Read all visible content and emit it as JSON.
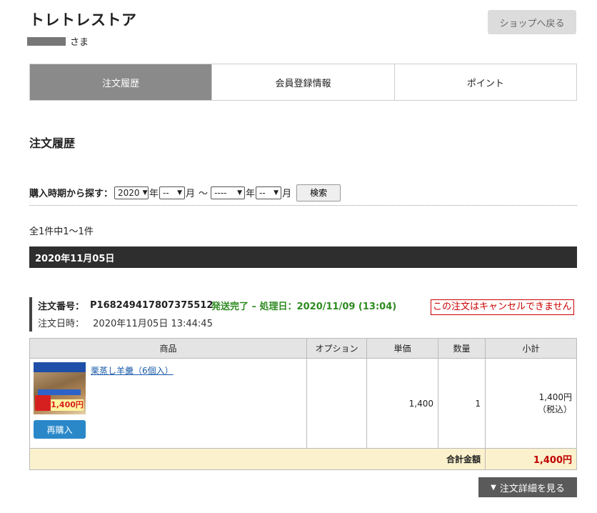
{
  "header": {
    "shop_name": "トレトレストア",
    "user_suffix": "さま",
    "back_button": "ショップへ戻る"
  },
  "tabs": [
    {
      "label": "注文履歴",
      "active": true
    },
    {
      "label": "会員登録情報",
      "active": false
    },
    {
      "label": "ポイント",
      "active": false
    }
  ],
  "section_title": "注文履歴",
  "search": {
    "label": "購入時期から探す：",
    "year_from": "2020",
    "year_unit": "年",
    "month_from": "--",
    "month_unit": "月",
    "tilde": "～",
    "year_to": "----",
    "month_to": "--",
    "button": "検索"
  },
  "result_count": "全1件中1～1件",
  "date_group": "2020年11月05日",
  "order": {
    "number_label": "注文番号：",
    "number": "P168249417807375512",
    "status": "発送完了 – 処理日：2020/11/09 (13:04)",
    "cancel_note": "この注文はキャンセルできません",
    "date_label": "注文日時：",
    "date": "2020年11月05日 13:44:45"
  },
  "table": {
    "headers": {
      "product": "商品",
      "option": "オプション",
      "price": "単価",
      "qty": "数量",
      "subtotal": "小計"
    },
    "item": {
      "name": "栗蒸し羊羹（6個入）",
      "thumb_price": "1,400円",
      "rebuy": "再購入",
      "option": "",
      "price": "1,400",
      "qty": "1",
      "subtotal": "1,400円",
      "tax_note": "（税込）"
    },
    "total_label": "合計金額",
    "total_value": "1,400円"
  },
  "detail_button": "注文詳細を見る",
  "colors": {
    "active_tab": "#8a8a8a",
    "date_bar": "#2e2e2e",
    "status_green": "#2e8b21",
    "cancel_red": "#cc0000",
    "rebuy_blue": "#2a88c9",
    "total_bg": "#fbf1cc"
  }
}
